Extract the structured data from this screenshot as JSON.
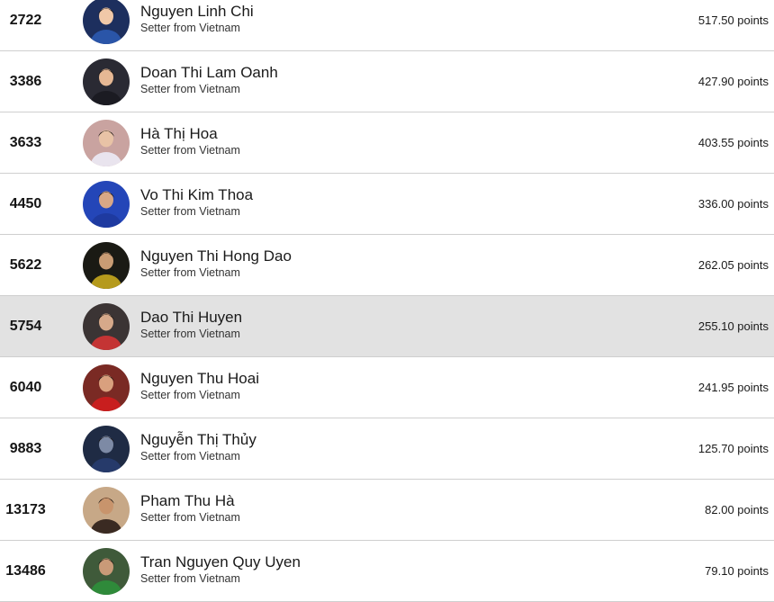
{
  "rankings": [
    {
      "rank": "2722",
      "name": "Nguyen Linh Chi",
      "role": "Setter from Vietnam",
      "points": "517.50 points",
      "avatar_bg": "#1d2f5e",
      "avatar_fg": "#f0c8a8",
      "jersey": "#2a55a8",
      "highlighted": false
    },
    {
      "rank": "3386",
      "name": "Doan Thi Lam Oanh",
      "role": "Setter from Vietnam",
      "points": "427.90 points",
      "avatar_bg": "#2a2a33",
      "avatar_fg": "#e6b894",
      "jersey": "#1b1b22",
      "highlighted": false
    },
    {
      "rank": "3633",
      "name": "Hà Thị Hoa",
      "role": "Setter from Vietnam",
      "points": "403.55 points",
      "avatar_bg": "#c9a3a0",
      "avatar_fg": "#e8c3a6",
      "jersey": "#e9e4ee",
      "highlighted": false
    },
    {
      "rank": "4450",
      "name": "Vo Thi Kim Thoa",
      "role": "Setter from Vietnam",
      "points": "336.00 points",
      "avatar_bg": "#2446b8",
      "avatar_fg": "#d9a886",
      "jersey": "#1e3aa0",
      "highlighted": false
    },
    {
      "rank": "5622",
      "name": "Nguyen Thi Hong Dao",
      "role": "Setter from Vietnam",
      "points": "262.05 points",
      "avatar_bg": "#1a1a14",
      "avatar_fg": "#c99c74",
      "jersey": "#b59a1c",
      "highlighted": false
    },
    {
      "rank": "5754",
      "name": "Dao Thi Huyen",
      "role": "Setter from Vietnam",
      "points": "255.10 points",
      "avatar_bg": "#3b3434",
      "avatar_fg": "#d6a98a",
      "jersey": "#c43434",
      "highlighted": true
    },
    {
      "rank": "6040",
      "name": "Nguyen Thu Hoai",
      "role": "Setter from Vietnam",
      "points": "241.95 points",
      "avatar_bg": "#7a2a24",
      "avatar_fg": "#d9a07e",
      "jersey": "#c81e1e",
      "highlighted": false
    },
    {
      "rank": "9883",
      "name": "Nguyễn Thị Thủy",
      "role": "Setter from Vietnam",
      "points": "125.70 points",
      "avatar_bg": "#1f2b44",
      "avatar_fg": "#7d8aa5",
      "jersey": "#263a6a",
      "highlighted": false
    },
    {
      "rank": "13173",
      "name": "Pham Thu Hà",
      "role": "Setter from Vietnam",
      "points": "82.00 points",
      "avatar_bg": "#c7a887",
      "avatar_fg": "#c8946c",
      "jersey": "#3a2a22",
      "highlighted": false
    },
    {
      "rank": "13486",
      "name": "Tran Nguyen Quy Uyen",
      "role": "Setter from Vietnam",
      "points": "79.10 points",
      "avatar_bg": "#3f5a3a",
      "avatar_fg": "#c99a78",
      "jersey": "#2f8a3a",
      "highlighted": false
    }
  ]
}
